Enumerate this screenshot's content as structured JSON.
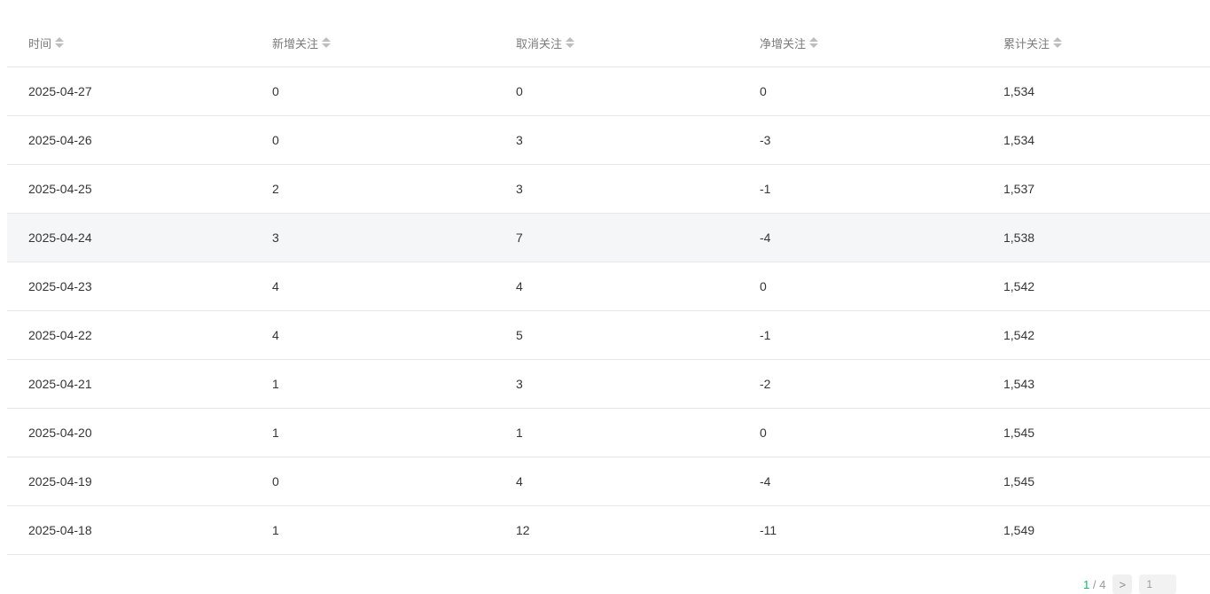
{
  "table": {
    "columns": [
      "时间",
      "新增关注",
      "取消关注",
      "净增关注",
      "累计关注"
    ],
    "rows": [
      [
        "2025-04-27",
        "0",
        "0",
        "0",
        "1,534"
      ],
      [
        "2025-04-26",
        "0",
        "3",
        "-3",
        "1,534"
      ],
      [
        "2025-04-25",
        "2",
        "3",
        "-1",
        "1,537"
      ],
      [
        "2025-04-24",
        "3",
        "7",
        "-4",
        "1,538"
      ],
      [
        "2025-04-23",
        "4",
        "4",
        "0",
        "1,542"
      ],
      [
        "2025-04-22",
        "4",
        "5",
        "-1",
        "1,542"
      ],
      [
        "2025-04-21",
        "1",
        "3",
        "-2",
        "1,543"
      ],
      [
        "2025-04-20",
        "1",
        "1",
        "0",
        "1,545"
      ],
      [
        "2025-04-19",
        "0",
        "4",
        "-4",
        "1,545"
      ],
      [
        "2025-04-18",
        "1",
        "12",
        "-11",
        "1,549"
      ]
    ],
    "highlighted_row": 3
  },
  "pager": {
    "current": "1",
    "separator": "/",
    "total": "4",
    "next_label": ">",
    "jump_value": "1",
    "colors": {
      "current": "#07c160"
    }
  }
}
